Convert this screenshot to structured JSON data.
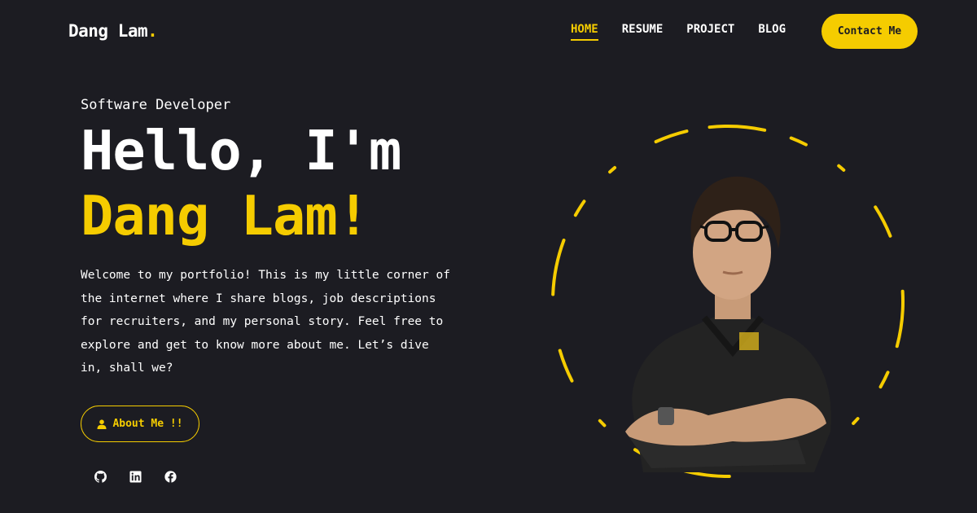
{
  "header": {
    "logo_text": "Dang Lam",
    "logo_dot": ".",
    "nav": [
      {
        "label": "HOME",
        "active": true
      },
      {
        "label": "RESUME",
        "active": false
      },
      {
        "label": "PROJECT",
        "active": false
      },
      {
        "label": "BLOG",
        "active": false
      }
    ],
    "contact_label": "Contact Me"
  },
  "hero": {
    "subtitle": "Software Developer",
    "greeting": "Hello, I'm",
    "name": "Dang Lam!",
    "intro": "Welcome to my portfolio! This is my little corner of the internet where I share blogs, job descriptions for recruiters, and my personal story. Feel free to explore and get to know more about me. Let’s dive in, shall we?",
    "about_label": "About Me !!",
    "about_icon": "user-icon"
  },
  "socials": [
    {
      "icon": "github-icon"
    },
    {
      "icon": "linkedin-icon"
    },
    {
      "icon": "facebook-icon"
    }
  ],
  "colors": {
    "background": "#1c1c22",
    "accent": "#f5cc00",
    "text": "#ffffff"
  }
}
